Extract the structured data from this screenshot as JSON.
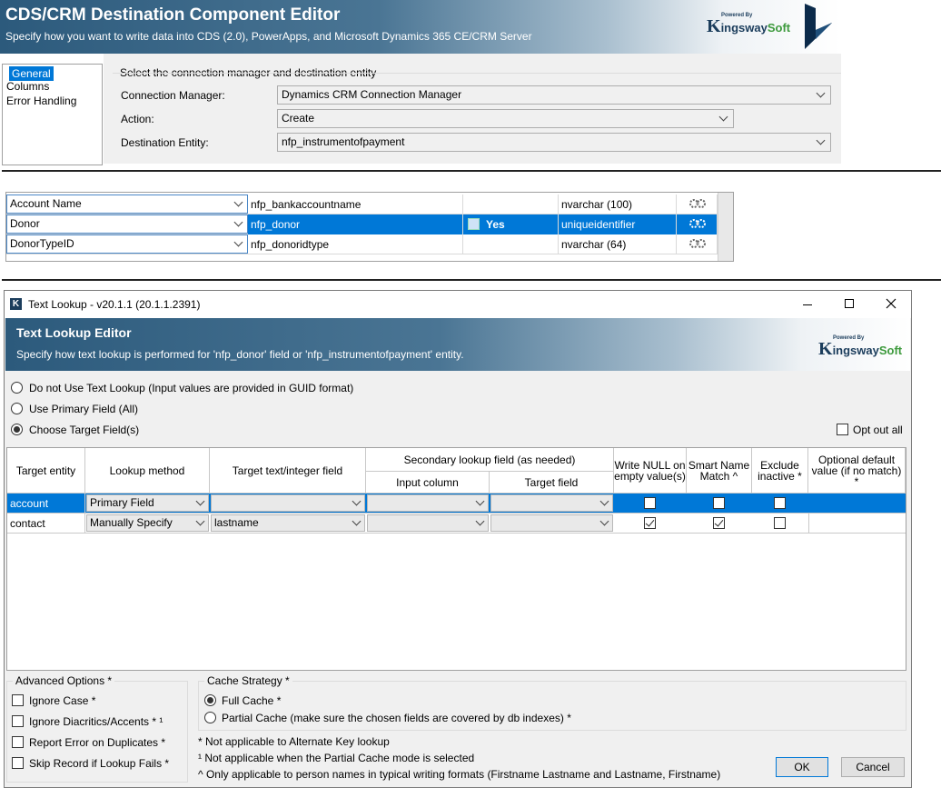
{
  "editor": {
    "title": "CDS/CRM Destination Component Editor",
    "subtitle": "Specify how you want to write data into CDS (2.0), PowerApps, and Microsoft Dynamics 365 CE/CRM Server",
    "logo": {
      "powered_by": "Powered By",
      "k": "K",
      "ingsway": "ingsway",
      "soft": "Soft"
    },
    "nav": [
      "General",
      "Columns",
      "Error Handling"
    ],
    "section_label": "Select the connection manager and destination entity",
    "connection_manager_label": "Connection Manager:",
    "connection_manager_value": "Dynamics CRM Connection Manager",
    "action_label": "Action:",
    "action_value": "Create",
    "destination_entity_label": "Destination Entity:",
    "destination_entity_value": "nfp_instrumentofpayment"
  },
  "mapping_rows": [
    {
      "source": "Account Name",
      "target": "nfp_bankaccountname",
      "key": "",
      "type": "nvarchar (100)"
    },
    {
      "source": "Donor",
      "target": "nfp_donor",
      "key": "Yes",
      "type": "uniqueidentifier"
    },
    {
      "source": "DonorTypeID",
      "target": "nfp_donoridtype",
      "key": "",
      "type": "nvarchar (64)"
    }
  ],
  "dialog": {
    "window_title": "Text Lookup - v20.1.1 (20.1.1.2391)",
    "app_icon": "K",
    "title": "Text Lookup Editor",
    "subtitle": "Specify how text lookup is performed for 'nfp_donor' field or 'nfp_instrumentofpayment' entity.",
    "options": {
      "no_lookup": "Do not Use Text Lookup (Input values are provided in GUID format)",
      "primary": "Use Primary Field (All)",
      "choose": "Choose Target Field(s)",
      "selected": "choose"
    },
    "opt_out_all": "Opt out all",
    "grid": {
      "headers": {
        "target_entity": "Target entity",
        "lookup_method": "Lookup method",
        "target_field": "Target text/integer field",
        "secondary": "Secondary lookup field (as needed)",
        "input_column": "Input column",
        "secondary_target": "Target field",
        "write_null": "Write NULL on empty value(s)",
        "smart_name": "Smart Name Match ^",
        "exclude_inactive": "Exclude inactive *",
        "optional_default": "Optional default value (if no match) *"
      },
      "rows": [
        {
          "entity": "account",
          "method": "Primary Field",
          "field": "",
          "write_null": false,
          "smart_name": false,
          "exclude_inactive": false
        },
        {
          "entity": "contact",
          "method": "Manually Specify",
          "field": "lastname",
          "write_null": true,
          "smart_name": true,
          "exclude_inactive": false
        }
      ]
    },
    "advanced": {
      "legend": "Advanced Options *",
      "ignore_case": "Ignore Case *",
      "ignore_diacritics": "Ignore Diacritics/Accents * ¹",
      "report_error": "Report Error on Duplicates *",
      "skip_record": "Skip Record if Lookup Fails *"
    },
    "cache": {
      "legend": "Cache Strategy *",
      "full": "Full Cache *",
      "partial": "Partial Cache (make sure the chosen fields are covered by db indexes) *"
    },
    "notes": {
      "n1": "* Not applicable to Alternate Key lookup",
      "n2": "¹ Not applicable when the Partial Cache mode is selected",
      "n3": "^ Only applicable to person names in typical writing formats (Firstname Lastname and Lastname, Firstname)"
    },
    "ok": "OK",
    "cancel": "Cancel"
  }
}
